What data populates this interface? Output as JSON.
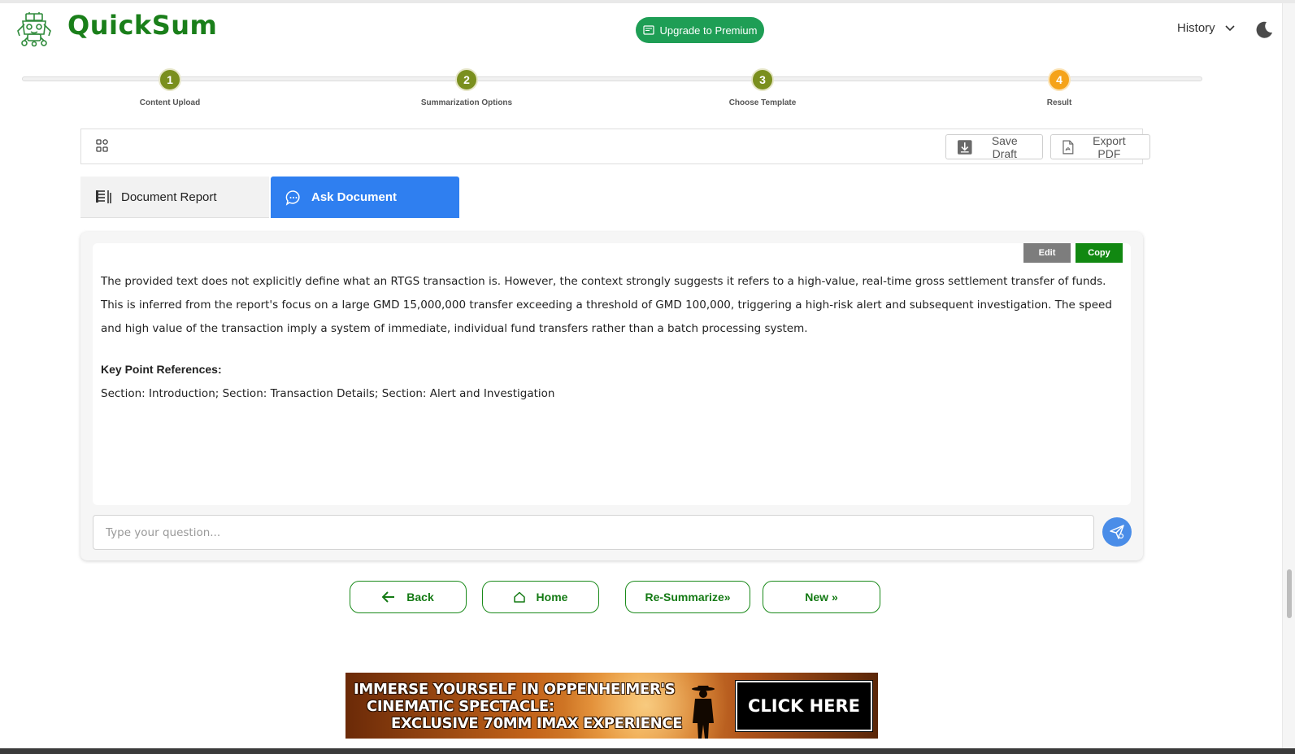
{
  "app": {
    "name": "QuickSum"
  },
  "header": {
    "upgrade_label": "Upgrade to Premium",
    "history_label": "History"
  },
  "stepper": {
    "steps": [
      {
        "number": "1",
        "label": "Content Upload",
        "state": "complete"
      },
      {
        "number": "2",
        "label": "Summarization Options",
        "state": "complete"
      },
      {
        "number": "3",
        "label": "Choose Template",
        "state": "complete"
      },
      {
        "number": "4",
        "label": "Result",
        "state": "active"
      }
    ]
  },
  "toolbar": {
    "save_draft_label": "Save Draft",
    "export_pdf_label": "Export PDF"
  },
  "tabs": {
    "report_label": "Document Report",
    "ask_label": "Ask Document",
    "active": "ask"
  },
  "answer": {
    "edit_label": "Edit",
    "copy_label": "Copy",
    "text": "The provided text does not explicitly define what an RTGS transaction is. However, the context strongly suggests it refers to a high-value, real-time gross settlement transfer of funds. This is inferred from the report's focus on a large GMD 15,000,000 transfer exceeding a threshold of GMD 100,000, triggering a high-risk alert and subsequent investigation. The speed and high value of the transaction imply a system of immediate, individual fund transfers rather than a batch processing system.",
    "key_points_title": "Key Point References:",
    "key_points_text": "Section: Introduction; Section: Transaction Details; Section: Alert and Investigation"
  },
  "question": {
    "placeholder": "Type your question..."
  },
  "nav": {
    "back_label": "Back",
    "home_label": "Home",
    "resummarize_label": "Re-Summarize»",
    "new_label": "New »"
  },
  "ad": {
    "line1": "IMMERSE YOURSELF IN OPPENHEIMER'S",
    "line2": "CINEMATIC SPECTACLE:",
    "line3": "EXCLUSIVE 70MM IMAX EXPERIENCE",
    "cta": "CLICK HERE"
  },
  "colors": {
    "brand_green": "#1a7f1a",
    "step_complete": "#7a8f1e",
    "step_active": "#f5a31a",
    "tab_active": "#2f7ff0",
    "upgrade_bg": "#1e9e55",
    "send_bg": "#4a8de8"
  },
  "icons": {
    "logo": "robot-icon",
    "upgrade": "card-icon",
    "history": "chevron-down-icon",
    "theme": "moon-icon",
    "toolbar": "grid-icon",
    "save": "download-icon",
    "export": "pdf-icon",
    "report_tab": "document-lines-icon",
    "ask_tab": "chat-bubble-icon",
    "send": "send-icon",
    "back": "arrow-left-icon",
    "home": "home-icon"
  }
}
